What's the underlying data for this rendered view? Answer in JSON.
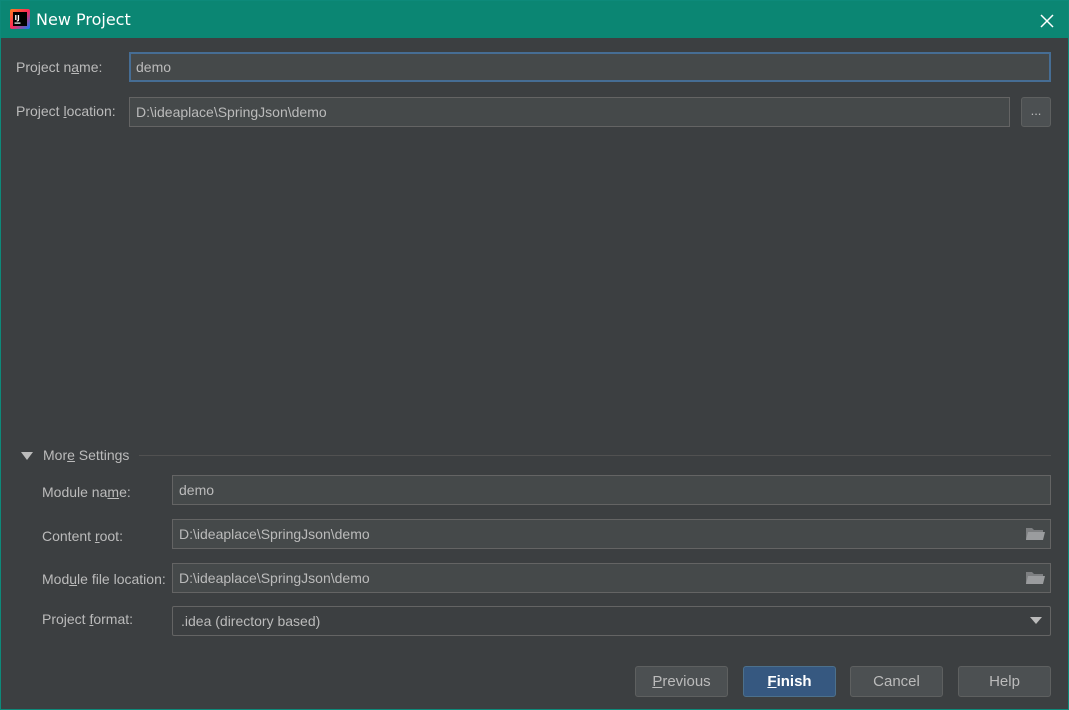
{
  "window": {
    "title": "New Project",
    "titlebar_color": "#0b8673"
  },
  "form": {
    "project_name": {
      "label_pre": "Project n",
      "label_u": "a",
      "label_post": "me:",
      "value": "demo"
    },
    "project_location": {
      "label_pre": "Project ",
      "label_u": "l",
      "label_post": "ocation:",
      "value": "D:\\ideaplace\\SpringJson\\demo",
      "browse_label": "..."
    }
  },
  "more_settings": {
    "label_pre": "Mor",
    "label_u": "e",
    "label_post": " Settings",
    "module_name": {
      "label_pre": "Module na",
      "label_u": "m",
      "label_post": "e:",
      "value": "demo"
    },
    "content_root": {
      "label_pre": "Content ",
      "label_u": "r",
      "label_post": "oot:",
      "value": "D:\\ideaplace\\SpringJson\\demo"
    },
    "module_file_location": {
      "label_pre": "Mod",
      "label_u": "u",
      "label_post": "le file location:",
      "value": "D:\\ideaplace\\SpringJson\\demo"
    },
    "project_format": {
      "label_pre": "Project ",
      "label_u": "f",
      "label_post": "ormat:",
      "value": ".idea (directory based)"
    }
  },
  "buttons": {
    "previous": {
      "u": "P",
      "rest": "revious"
    },
    "finish": {
      "u": "F",
      "rest": "inish"
    },
    "cancel": "Cancel",
    "help": "Help"
  },
  "colors": {
    "background": "#3c3f41",
    "field_bg": "#45494a",
    "focus_border": "#466d94",
    "primary_button": "#365880"
  }
}
